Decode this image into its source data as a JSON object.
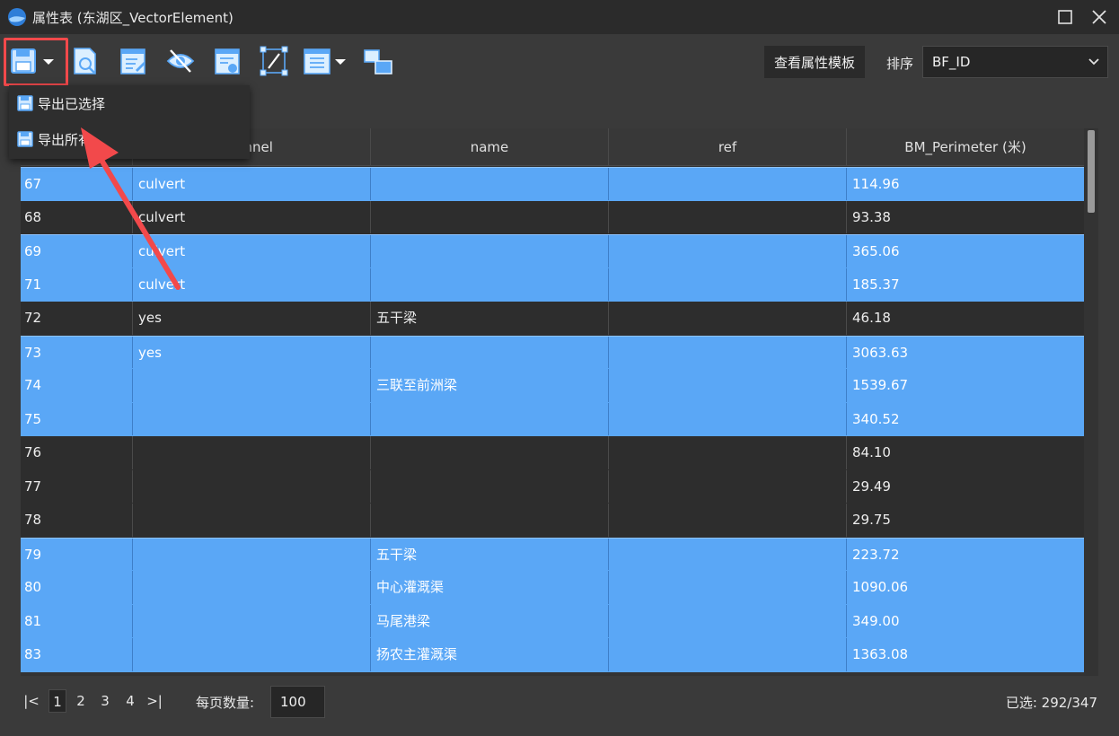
{
  "window": {
    "title": "属性表 (东湖区_VectorElement)"
  },
  "toolbar": {
    "view_template_label": "查看属性模板",
    "sort_label": "排序",
    "sort_value": "BF_ID"
  },
  "export_menu": {
    "items": [
      {
        "label": "导出已选择"
      },
      {
        "label": "导出所有"
      }
    ]
  },
  "table": {
    "columns": [
      "",
      "tunnel",
      "name",
      "ref",
      "BM_Perimeter (米)"
    ],
    "rows": [
      {
        "id": "67",
        "tunnel": "culvert",
        "name": "",
        "ref": "",
        "perimeter": "114.96",
        "selected": true
      },
      {
        "id": "68",
        "tunnel": "culvert",
        "name": "",
        "ref": "",
        "perimeter": "93.38",
        "selected": false
      },
      {
        "id": "69",
        "tunnel": "culvert",
        "name": "",
        "ref": "",
        "perimeter": "365.06",
        "selected": true
      },
      {
        "id": "71",
        "tunnel": "culvert",
        "name": "",
        "ref": "",
        "perimeter": "185.37",
        "selected": true
      },
      {
        "id": "72",
        "tunnel": "yes",
        "name": "五干梁",
        "ref": "",
        "perimeter": "46.18",
        "selected": false
      },
      {
        "id": "73",
        "tunnel": "yes",
        "name": "",
        "ref": "",
        "perimeter": "3063.63",
        "selected": true
      },
      {
        "id": "74",
        "tunnel": "",
        "name": "三联至前洲梁",
        "ref": "",
        "perimeter": "1539.67",
        "selected": true
      },
      {
        "id": "75",
        "tunnel": "",
        "name": "",
        "ref": "",
        "perimeter": "340.52",
        "selected": true
      },
      {
        "id": "76",
        "tunnel": "",
        "name": "",
        "ref": "",
        "perimeter": "84.10",
        "selected": false
      },
      {
        "id": "77",
        "tunnel": "",
        "name": "",
        "ref": "",
        "perimeter": "29.49",
        "selected": false
      },
      {
        "id": "78",
        "tunnel": "",
        "name": "",
        "ref": "",
        "perimeter": "29.75",
        "selected": false
      },
      {
        "id": "79",
        "tunnel": "",
        "name": "五干梁",
        "ref": "",
        "perimeter": "223.72",
        "selected": true
      },
      {
        "id": "80",
        "tunnel": "",
        "name": "中心灌溉渠",
        "ref": "",
        "perimeter": "1090.06",
        "selected": true
      },
      {
        "id": "81",
        "tunnel": "",
        "name": "马尾港梁",
        "ref": "",
        "perimeter": "349.00",
        "selected": true
      },
      {
        "id": "83",
        "tunnel": "",
        "name": "扬农主灌溉渠",
        "ref": "",
        "perimeter": "1363.08",
        "selected": true
      }
    ]
  },
  "pagination": {
    "first": "|<",
    "pages": [
      "1",
      "2",
      "3",
      "4"
    ],
    "last": ">|",
    "current": "1",
    "per_page_label": "每页数量:",
    "per_page_value": "100"
  },
  "status": {
    "selected_text": "已选: 292/347"
  },
  "colors": {
    "selected_row": "#5aa7f6",
    "highlight": "#f2494b",
    "annotation_arrow": "#f2494b"
  }
}
